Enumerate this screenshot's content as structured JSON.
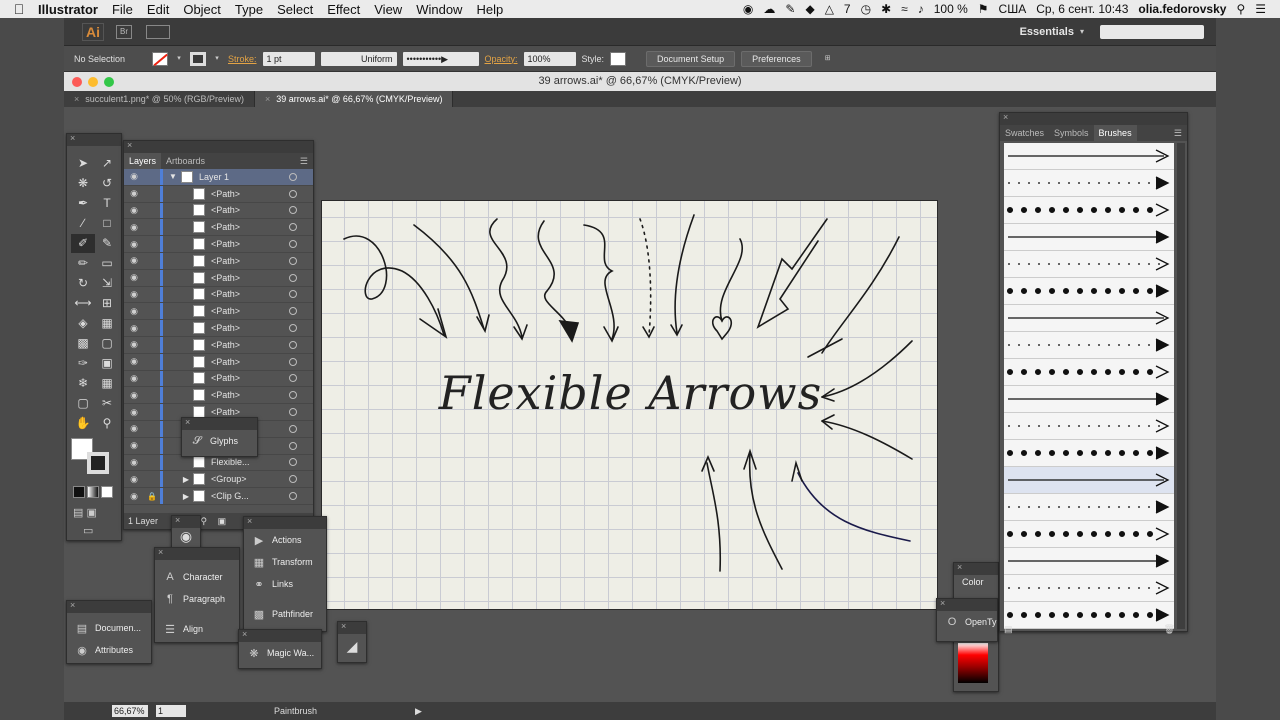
{
  "menubar": {
    "app": "Illustrator",
    "items": [
      "File",
      "Edit",
      "Object",
      "Type",
      "Select",
      "Effect",
      "View",
      "Window",
      "Help"
    ],
    "status": {
      "badge": "7",
      "battery": "100 %",
      "locale": "США",
      "datetime": "Ср, 6 сент.  10:43",
      "user": "olia.fedorovsky"
    }
  },
  "appbar": {
    "logo": "Ai",
    "bridge": "Br",
    "workspace": "Essentials",
    "search_placeholder": ""
  },
  "control": {
    "selection": "No Selection",
    "stroke_label": "Stroke:",
    "stroke_value": "1 pt",
    "profile": "Uniform",
    "opacity_label": "Opacity:",
    "opacity_value": "100%",
    "style_label": "Style:",
    "doc_setup": "Document Setup",
    "preferences": "Preferences"
  },
  "document": {
    "title": "39 arrows.ai* @ 66,67% (CMYK/Preview)",
    "tabs": [
      {
        "label": "succulent1.png* @ 50% (RGB/Preview)"
      },
      {
        "label": "39 arrows.ai* @ 66,67% (CMYK/Preview)"
      }
    ],
    "artboard_title": "Flexible Arrows"
  },
  "layers": {
    "tabs": [
      "Layers",
      "Artboards"
    ],
    "layer_name": "Layer 1",
    "rows": [
      "<Path>",
      "<Path>",
      "<Path>",
      "<Path>",
      "<Path>",
      "<Path>",
      "<Path>",
      "<Path>",
      "<Path>",
      "<Path>",
      "<Path>",
      "<Path>",
      "<Path>",
      "<Path>",
      "",
      "",
      "Flexible...",
      "<Group>",
      "<Clip G..."
    ],
    "footer": "1 Layer"
  },
  "panels": {
    "glyphs": "Glyphs",
    "actions": "Actions",
    "transform": "Transform",
    "links": "Links",
    "pathfinder": "Pathfinder",
    "character": "Character",
    "paragraph": "Paragraph",
    "align": "Align",
    "document_info": "Documen...",
    "attributes": "Attributes",
    "magic_wand": "Magic Wa...",
    "color": "Color",
    "opentype": "OpenTy"
  },
  "brushes": {
    "tabs": [
      "Swatches",
      "Symbols",
      "Brushes"
    ]
  },
  "statusbar": {
    "zoom": "66,67%",
    "artboard_num": "1",
    "tool": "Paintbrush"
  },
  "colors": {
    "accent": "#e3a345",
    "layer_blue": "#4f7fd8",
    "artboard": "#eeeee6"
  }
}
